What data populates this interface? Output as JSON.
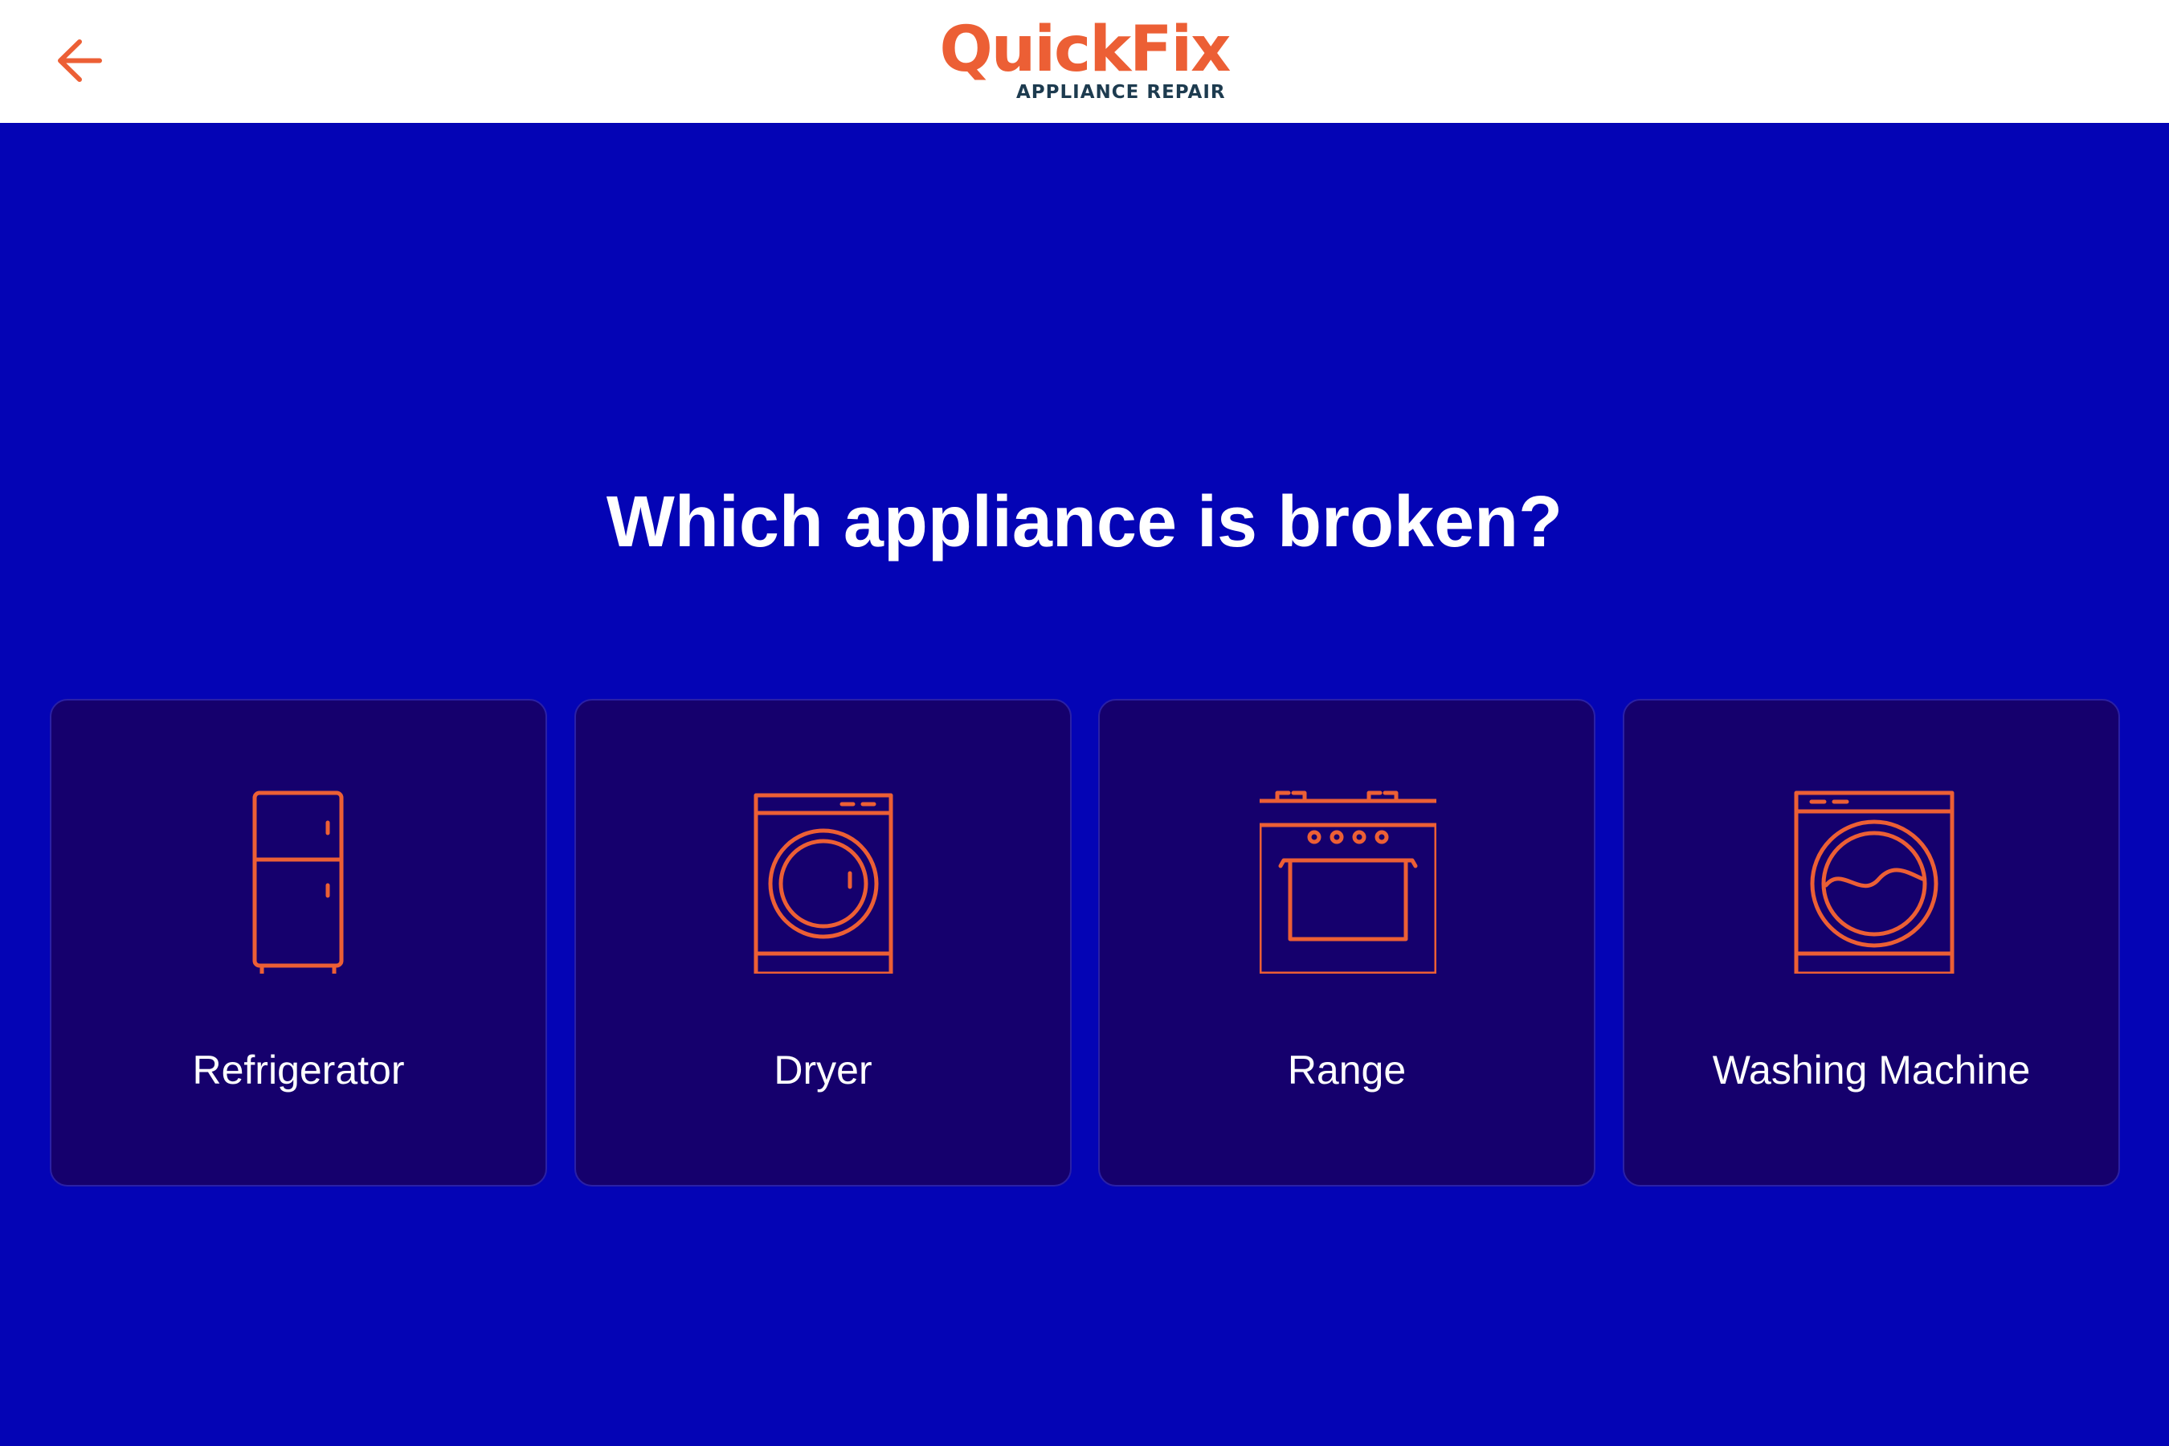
{
  "header": {
    "back_label": "Back",
    "logo": {
      "brand": "QuickFix",
      "tagline": "APPLIANCE REPAIR"
    }
  },
  "main": {
    "question": "Which appliance is broken?",
    "options": [
      {
        "label": "Refrigerator",
        "icon": "refrigerator-icon"
      },
      {
        "label": "Dryer",
        "icon": "dryer-icon"
      },
      {
        "label": "Range",
        "icon": "range-icon"
      },
      {
        "label": "Washing Machine",
        "icon": "washing-machine-icon"
      }
    ]
  },
  "colors": {
    "background": "#0404b5",
    "card": "#15006d",
    "accent": "#ec5f35",
    "header": "#ffffff",
    "tagline": "#1d3b4f"
  }
}
